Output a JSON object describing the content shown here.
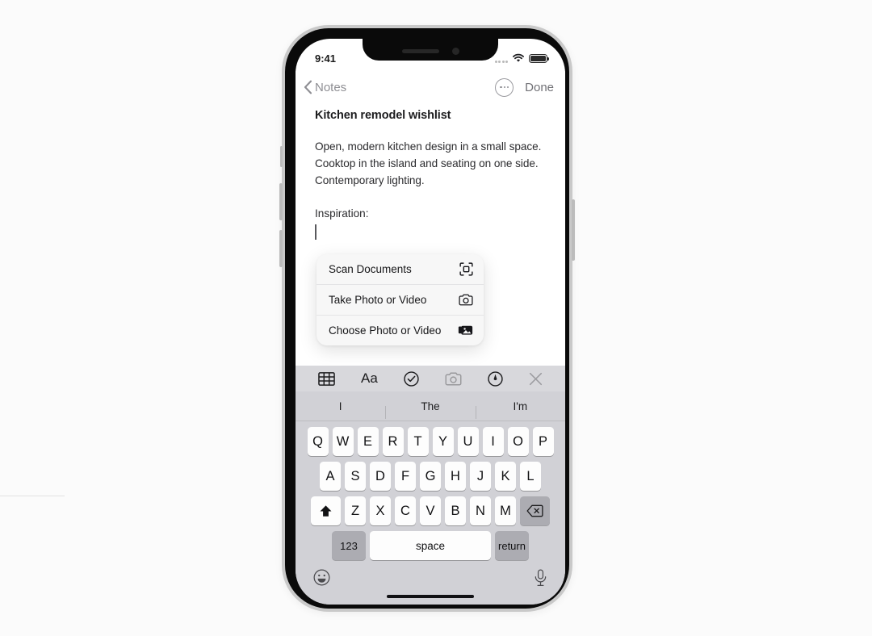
{
  "device": {
    "name": "iphone-12",
    "frame_color": "#c9c9c9",
    "bezel_color": "#0a0a0a"
  },
  "status_bar": {
    "time": "9:41",
    "cellular_icon": "signal-dots-icon",
    "wifi_icon": "wifi-icon",
    "battery_icon": "battery-full-icon"
  },
  "nav_bar": {
    "back_icon": "chevron-left-icon",
    "back_label": "Notes",
    "more_icon": "ellipsis-circle-icon",
    "done_label": "Done"
  },
  "note": {
    "title": "Kitchen remodel wishlist",
    "paragraph": "Open, modern kitchen design in a small space. Cooktop in the island and seating on one side. Contemporary lighting.",
    "label": "Inspiration:",
    "caret_visible": true
  },
  "action_menu": {
    "items": [
      {
        "label": "Scan Documents",
        "icon": "scan-documents-icon"
      },
      {
        "label": "Take Photo or Video",
        "icon": "camera-icon"
      },
      {
        "label": "Choose Photo or Video",
        "icon": "photo-library-icon"
      }
    ]
  },
  "notes_toolbar": {
    "items": [
      {
        "name": "table-icon",
        "label": "",
        "active": false
      },
      {
        "name": "text-format-icon",
        "label": "Aa",
        "active": false
      },
      {
        "name": "checklist-icon",
        "label": "",
        "active": false
      },
      {
        "name": "camera-icon",
        "label": "",
        "active": true
      },
      {
        "name": "markup-pen-icon",
        "label": "",
        "active": false
      },
      {
        "name": "close-icon",
        "label": "",
        "active": false
      }
    ]
  },
  "keyboard": {
    "predictions": [
      "I",
      "The",
      "I'm"
    ],
    "row1": [
      "Q",
      "W",
      "E",
      "R",
      "T",
      "Y",
      "U",
      "I",
      "O",
      "P"
    ],
    "row2": [
      "A",
      "S",
      "D",
      "F",
      "G",
      "H",
      "J",
      "K",
      "L"
    ],
    "row3": [
      "Z",
      "X",
      "C",
      "V",
      "B",
      "N",
      "M"
    ],
    "shift_icon": "shift-up-icon",
    "backspace_icon": "backspace-icon",
    "numbers_label": "123",
    "space_label": "space",
    "return_label": "return",
    "emoji_icon": "emoji-smiley-icon",
    "dictation_icon": "microphone-icon"
  }
}
